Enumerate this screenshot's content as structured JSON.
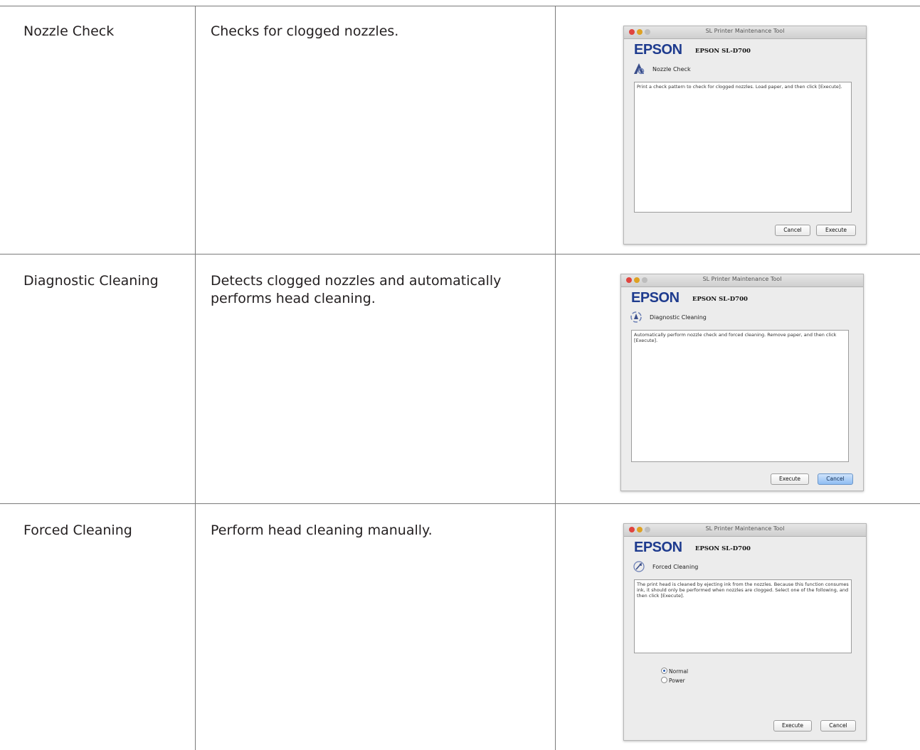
{
  "rows": [
    {
      "feature": "Nozzle Check",
      "description": "Checks for clogged nozzles.",
      "dialog": {
        "title": "SL Printer Maintenance Tool",
        "brand": "EPSON",
        "model": "EPSON SL-D700",
        "function_name": "Nozzle Check",
        "icon": "nozzle-check-icon",
        "text": "Print a check pattern to check for clogged nozzles. Load paper, and then click [Execute].",
        "buttons": [
          "Cancel",
          "Execute"
        ]
      }
    },
    {
      "feature": "Diagnostic Cleaning",
      "description": "Detects clogged nozzles and automatically performs head cleaning.",
      "dialog": {
        "title": "SL Printer Maintenance Tool",
        "brand": "EPSON",
        "model": "EPSON SL-D700",
        "function_name": "Diagnostic Cleaning",
        "icon": "diagnostic-cleaning-icon",
        "text": "Automatically perform nozzle check and forced cleaning. Remove paper, and then click [Execute].",
        "buttons": [
          "Execute",
          "Cancel"
        ]
      }
    },
    {
      "feature": "Forced Cleaning",
      "description": "Perform head cleaning manually.",
      "dialog": {
        "title": "SL Printer Maintenance Tool",
        "brand": "EPSON",
        "model": "EPSON SL-D700",
        "function_name": "Forced Cleaning",
        "icon": "forced-cleaning-icon",
        "text": "The print head is cleaned by ejecting ink from the nozzles. Because this function consumes ink, it should only be performed when nozzles are clogged. Select one of the following, and then click [Execute].",
        "options": [
          "Normal",
          "Power"
        ],
        "selected_option": "Normal",
        "buttons": [
          "Execute",
          "Cancel"
        ]
      }
    }
  ],
  "colors": {
    "brand": "#1e3b8e",
    "default_button": "#8fbdf3"
  }
}
